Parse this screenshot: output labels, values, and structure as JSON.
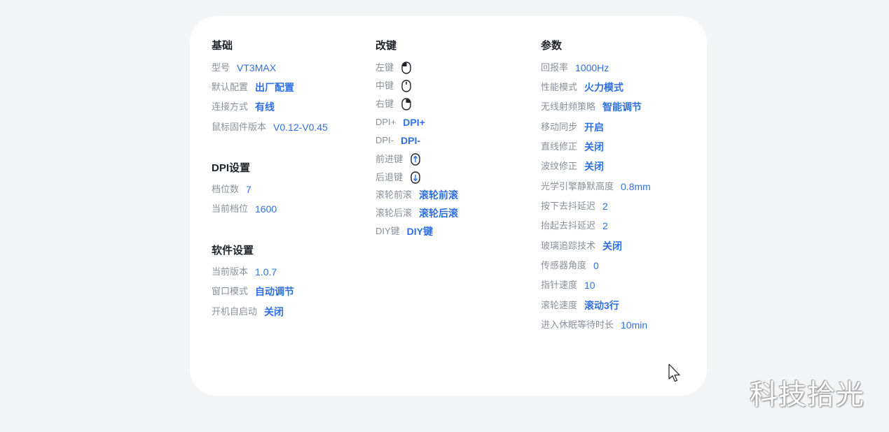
{
  "basic": {
    "title": "基础",
    "items": [
      {
        "label": "型号",
        "value": "VT3MAX"
      },
      {
        "label": "默认配置",
        "value": "出厂配置"
      },
      {
        "label": "连接方式",
        "value": "有线"
      },
      {
        "label": "鼠标固件版本",
        "value": "V0.12-V0.45"
      }
    ]
  },
  "dpi": {
    "title": "DPI设置",
    "items": [
      {
        "label": "档位数",
        "value": "7"
      },
      {
        "label": "当前档位",
        "value": "1600"
      }
    ]
  },
  "software": {
    "title": "软件设置",
    "items": [
      {
        "label": "当前版本",
        "value": "1.0.7"
      },
      {
        "label": "窗口模式",
        "value": "自动调节"
      },
      {
        "label": "开机自启动",
        "value": "关闭"
      }
    ]
  },
  "remap": {
    "title": "改键",
    "items": [
      {
        "label": "左键",
        "icon": "left-click-mouse-icon"
      },
      {
        "label": "中键",
        "icon": "middle-click-mouse-icon"
      },
      {
        "label": "右键",
        "icon": "right-click-mouse-icon"
      },
      {
        "label": "DPI+",
        "value": "DPI+"
      },
      {
        "label": "DPI-",
        "value": "DPI-"
      },
      {
        "label": "前进键",
        "icon": "forward-mouse-icon"
      },
      {
        "label": "后退键",
        "icon": "back-mouse-icon"
      },
      {
        "label": "滚轮前滚",
        "value": "滚轮前滚"
      },
      {
        "label": "滚轮后滚",
        "value": "滚轮后滚"
      },
      {
        "label": "DIY键",
        "value": "DIY键"
      }
    ]
  },
  "params": {
    "title": "参数",
    "items": [
      {
        "label": "回报率",
        "value": "1000Hz"
      },
      {
        "label": "性能模式",
        "value": "火力模式"
      },
      {
        "label": "无线射频策略",
        "value": "智能调节"
      },
      {
        "label": "移动同步",
        "value": "开启"
      },
      {
        "label": "直线修正",
        "value": "关闭"
      },
      {
        "label": "波纹修正",
        "value": "关闭"
      },
      {
        "label": "光学引擎静默高度",
        "value": "0.8mm"
      },
      {
        "label": "按下去抖延迟",
        "value": "2"
      },
      {
        "label": "抬起去抖延迟",
        "value": "2"
      },
      {
        "label": "玻璃追踪技术",
        "value": "关闭"
      },
      {
        "label": "传感器角度",
        "value": "0"
      },
      {
        "label": "指针速度",
        "value": "10"
      },
      {
        "label": "滚轮速度",
        "value": "滚动3行"
      },
      {
        "label": "进入休眠等待时长",
        "value": "10min"
      }
    ]
  },
  "watermark": "科技拾光",
  "colors": {
    "accent": "#2f6fe0",
    "label": "#8a8f99",
    "title": "#1f2329",
    "background": "#f3f4f6",
    "card": "#ffffff"
  }
}
